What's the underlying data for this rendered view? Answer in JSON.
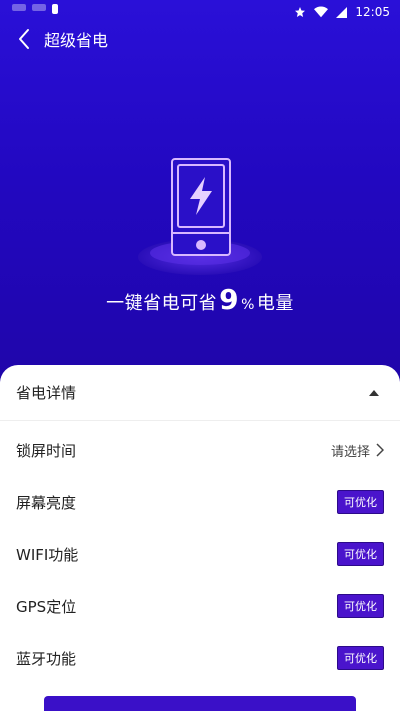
{
  "status_bar": {
    "time": "12:05"
  },
  "header": {
    "title": "超级省电"
  },
  "hero": {
    "text_before": "一键省电可省",
    "value": "9",
    "unit": "%",
    "text_after": "电量"
  },
  "details": {
    "title": "省电详情",
    "rows": [
      {
        "label": "锁屏时间",
        "value": "请选择"
      },
      {
        "label": "屏幕亮度",
        "badge": "可优化"
      },
      {
        "label": "WIFI功能",
        "badge": "可优化"
      },
      {
        "label": "GPS定位",
        "badge": "可优化"
      },
      {
        "label": "蓝牙功能",
        "badge": "可优化"
      }
    ]
  },
  "colors": {
    "hero_bg": "#2a10d8",
    "badge_bg": "#4a14cc"
  }
}
